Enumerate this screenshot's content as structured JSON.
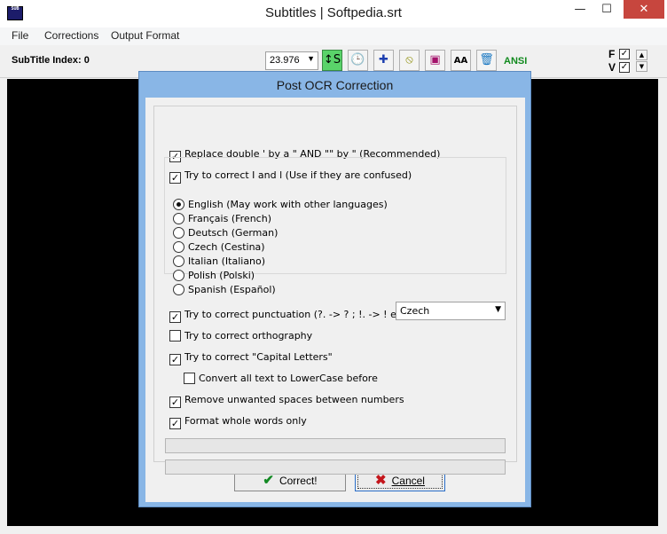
{
  "window": {
    "title": "Subtitles | Softpedia.srt",
    "icon_text": "SUB",
    "controls": {
      "minimize": "—",
      "maximize": "☐",
      "close": "✕"
    }
  },
  "menu": [
    "File",
    "Corrections",
    "Output Format"
  ],
  "toolbar": {
    "subtitle_index_label": "SubTitle Index: 0",
    "fps_value": "23.976",
    "tool_icons": [
      "timeline-icon",
      "clock-icon",
      "puzzle-icon",
      "no-sign-icon",
      "save-icon",
      "font-size-icon",
      "trash-icon"
    ],
    "timeline_glyph": "↕S",
    "font_glyph": "AA",
    "encoding": "ANSI",
    "f_label": "F",
    "v_label": "V",
    "f_checked": true,
    "v_checked": true
  },
  "dialog": {
    "title": "Post OCR Correction",
    "options": [
      {
        "label": "Replace double ' by a \"  AND \"\" by \" (Recommended)",
        "checked": true
      },
      {
        "label": "Try to correct I and l  (Use if they are confused)",
        "checked": true
      }
    ],
    "languages": [
      {
        "label": "English (May work with other languages)",
        "selected": true
      },
      {
        "label": "Français (French)",
        "selected": false
      },
      {
        "label": "Deutsch (German)",
        "selected": false
      },
      {
        "label": "Czech (Cestina)",
        "selected": false
      },
      {
        "label": "Italian (Italiano)",
        "selected": false
      },
      {
        "label": "Polish (Polski)",
        "selected": false
      },
      {
        "label": "Spanish (Español)",
        "selected": false
      }
    ],
    "options2": [
      {
        "label": "Try to correct punctuation (?. -> ? ; !. -> ! etc.)",
        "checked": true
      },
      {
        "label": "Try to correct orthography",
        "checked": false
      },
      {
        "label": "Try to correct \"Capital Letters\"",
        "checked": true
      },
      {
        "label": "Convert all text to LowerCase before",
        "checked": false
      },
      {
        "label": "Remove unwanted spaces between numbers",
        "checked": true
      },
      {
        "label": "Format whole words only",
        "checked": true
      }
    ],
    "orthography_language": "Czech",
    "progress": [
      0,
      0
    ],
    "correct_button": "Correct!",
    "cancel_button": "Cancel"
  }
}
